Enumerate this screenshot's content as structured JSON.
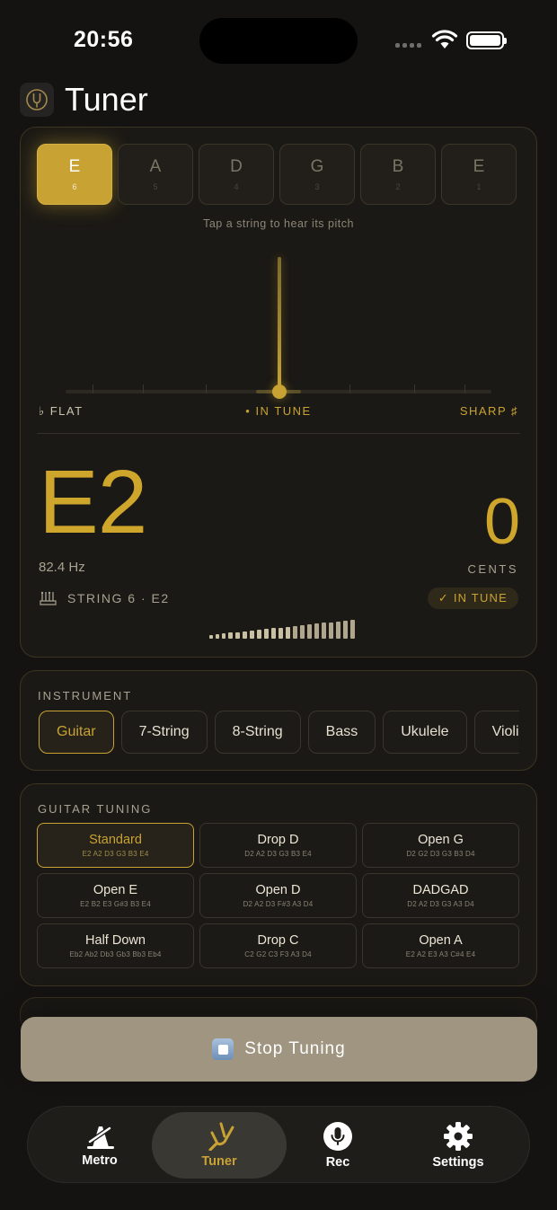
{
  "status": {
    "time": "20:56"
  },
  "header": {
    "title": "Tuner"
  },
  "strings": [
    {
      "note": "E",
      "number": "6",
      "active": true
    },
    {
      "note": "A",
      "number": "5"
    },
    {
      "note": "D",
      "number": "4"
    },
    {
      "note": "G",
      "number": "3"
    },
    {
      "note": "B",
      "number": "2"
    },
    {
      "note": "E",
      "number": "1"
    }
  ],
  "hint": "Tap a string to hear its pitch",
  "meter": {
    "flat_label": "♭  FLAT",
    "in_tune_label": "• IN TUNE",
    "sharp_label": "SHARP  ♯",
    "cents_offset": 0
  },
  "reading": {
    "note": "E2",
    "frequency": "82.4 Hz",
    "cents": "0",
    "cents_label": "CENTS",
    "string_info": "STRING 6  ·  E2",
    "status_badge": "✓ IN TUNE",
    "signal_level": 0.55
  },
  "instrument": {
    "label": "INSTRUMENT",
    "options": [
      "Guitar",
      "7-String",
      "8-String",
      "Bass",
      "Ukulele",
      "Violin"
    ],
    "selected": "Guitar"
  },
  "tuning": {
    "label": "GUITAR TUNING",
    "options": [
      {
        "name": "Standard",
        "notes": "E2 A2 D3 G3 B3 E4",
        "active": true
      },
      {
        "name": "Drop D",
        "notes": "D2 A2 D3 G3 B3 E4"
      },
      {
        "name": "Open G",
        "notes": "D2 G2 D3 G3 B3 D4"
      },
      {
        "name": "Open E",
        "notes": "E2 B2 E3 G#3 B3 E4"
      },
      {
        "name": "Open D",
        "notes": "D2 A2 D3 F#3 A3 D4"
      },
      {
        "name": "DADGAD",
        "notes": "D2 A2 D3 G3 A3 D4"
      },
      {
        "name": "Half Down",
        "notes": "Eb2 Ab2 Db3 Gb3 Bb3 Eb4"
      },
      {
        "name": "Drop C",
        "notes": "C2 G2 C3 F3 A3 D4"
      },
      {
        "name": "Open A",
        "notes": "E2 A2 E3 A3 C#4 E4"
      }
    ]
  },
  "action": {
    "stop_label": "Stop Tuning"
  },
  "tabs": [
    {
      "label": "Metro",
      "icon": "metronome-icon"
    },
    {
      "label": "Tuner",
      "icon": "tuning-fork-icon",
      "active": true
    },
    {
      "label": "Rec",
      "icon": "microphone-icon"
    },
    {
      "label": "Settings",
      "icon": "gear-icon"
    }
  ],
  "colors": {
    "accent": "#c8a233",
    "background": "#141311",
    "card": "#1b1915",
    "stop_button": "#9f9580"
  }
}
